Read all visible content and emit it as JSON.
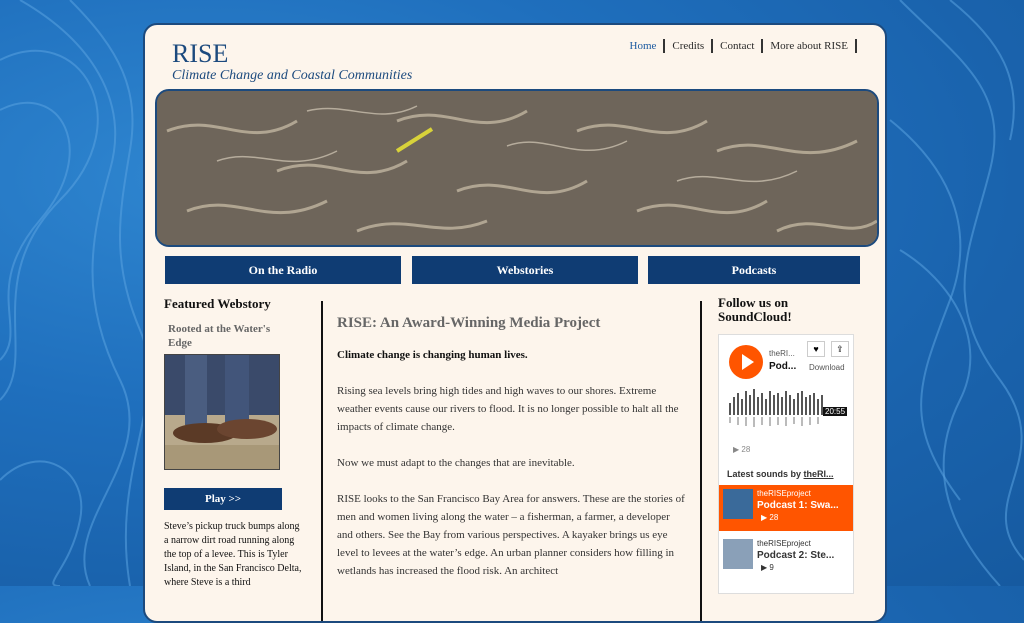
{
  "site": {
    "title": "RISE",
    "subtitle": "Climate Change and Coastal Communities"
  },
  "topnav": [
    {
      "label": "Home"
    },
    {
      "label": "Credits"
    },
    {
      "label": "Contact"
    },
    {
      "label": "More about RISE"
    }
  ],
  "mainnav": [
    {
      "label": "On the Radio"
    },
    {
      "label": "Webstories"
    },
    {
      "label": "Podcasts"
    }
  ],
  "featured": {
    "heading": "Featured Webstory",
    "story_title": "Rooted at the Water's Edge",
    "play_label": "Play >>",
    "excerpt": "Steve’s pickup truck bumps along a narrow dirt road running along the top of a levee. This is Tyler Island, in the San Francisco Delta, where Steve is a third"
  },
  "main": {
    "heading": "RISE: An Award-Winning Media Project",
    "lead": "Climate change is changing human lives.",
    "p1": "Rising sea levels bring high tides and high waves to our shores. Extreme weather events cause our rivers to flood. It is no longer possible to halt all the impacts of climate change.",
    "p2": "Now we must adapt to the changes that are inevitable.",
    "p3": "RISE looks to the San Francisco Bay Area for answers. These are the stories of men and women living along the water – a fisherman, a farmer, a developer and others. See the Bay from various perspectives. A kayaker brings us eye level to levees at the water’s edge. An urban planner considers how filling in wetlands has increased the flood risk. An architect"
  },
  "follow": {
    "heading": "Follow us on SoundCloud!"
  },
  "soundcloud": {
    "user": "theRI...",
    "track": "Pod...",
    "like_icon": "♥",
    "share_icon": "⇪",
    "download": "Download",
    "duration": "20:55",
    "plays": "▶ 28",
    "latest_prefix": "Latest sounds by ",
    "latest_user": "theRI...",
    "items": [
      {
        "user": "theRISEproject",
        "title": "Podcast 1: Swa...",
        "plays": "▶ 28"
      },
      {
        "user": "theRISEproject",
        "title": "Podcast 2: Ste...",
        "plays": "▶ 9"
      }
    ],
    "accent": "#ff5500"
  }
}
